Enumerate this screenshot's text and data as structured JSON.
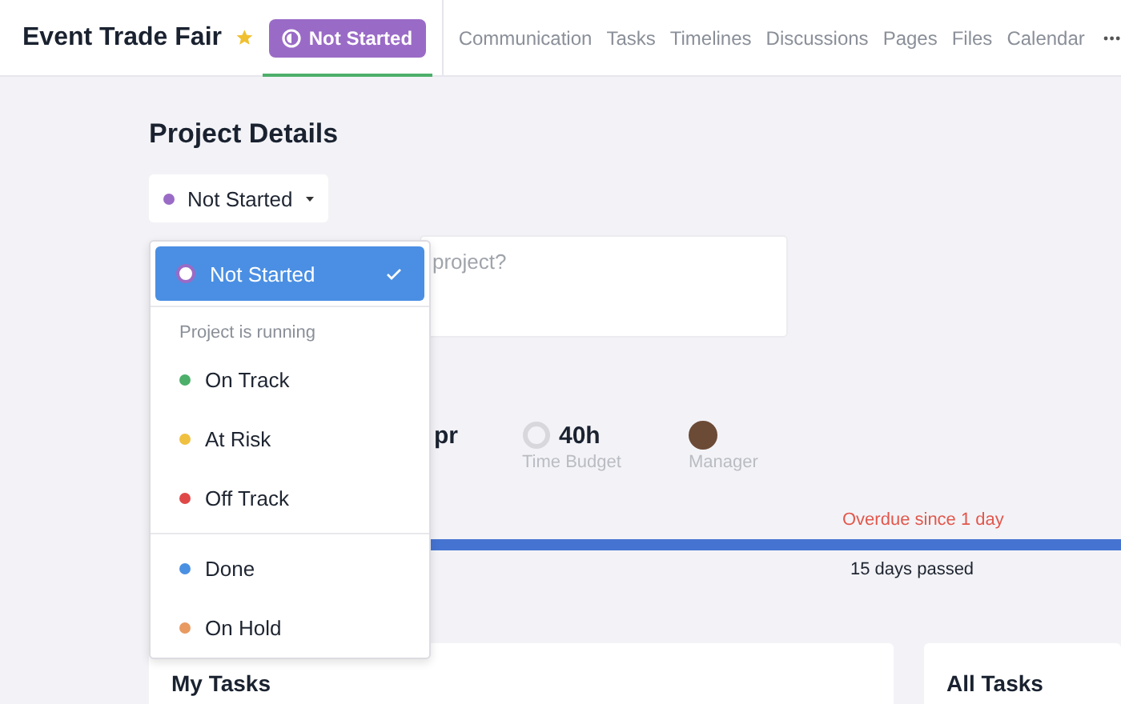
{
  "header": {
    "title": "Event Trade Fair",
    "starred": true,
    "badge": {
      "label": "Not Started",
      "color": "#9a6bc6",
      "selected": true
    },
    "nav": [
      {
        "label": "Communication",
        "selected": false
      },
      {
        "label": "Tasks",
        "selected": false
      },
      {
        "label": "Timelines",
        "selected": false
      },
      {
        "label": "Discussions",
        "selected": false
      },
      {
        "label": "Pages",
        "selected": false
      },
      {
        "label": "Files",
        "selected": false
      },
      {
        "label": "Calendar",
        "selected": false
      }
    ]
  },
  "page_title": "Project Details",
  "status_dropdown": {
    "label": "Not Started",
    "color": "#9a6bc6",
    "expanded": true
  },
  "description": {
    "placeholder": "project?"
  },
  "stats": [
    {
      "kind": "date",
      "value": "pr"
    },
    {
      "kind": "budget",
      "value": "40h",
      "label": "Time Budget"
    },
    {
      "kind": "person",
      "label": "Manager"
    }
  ],
  "timeline": {
    "overdue": "Overdue since 1 day",
    "level": 1,
    "passed": "15 days passed"
  },
  "menu": [
    {
      "kind": "option",
      "label": "Not Started",
      "color": "#9a6bc6",
      "selected": true
    },
    {
      "kind": "divider"
    },
    {
      "kind": "heading",
      "label": "Project is running"
    },
    {
      "kind": "option",
      "label": "On Track",
      "color": "#4caf6a",
      "selected": false
    },
    {
      "kind": "option",
      "label": "At Risk",
      "color": "#f0c040",
      "selected": false
    },
    {
      "kind": "option",
      "label": "Off Track",
      "color": "#e04848",
      "selected": false
    },
    {
      "kind": "divider"
    },
    {
      "kind": "option",
      "label": "Done",
      "color": "#4a90e2",
      "selected": false
    },
    {
      "kind": "option",
      "label": "On Hold",
      "color": "#e89a60",
      "selected": false
    }
  ],
  "cards": [
    {
      "title": "My Tasks"
    },
    {
      "title": "All Tasks"
    }
  ]
}
